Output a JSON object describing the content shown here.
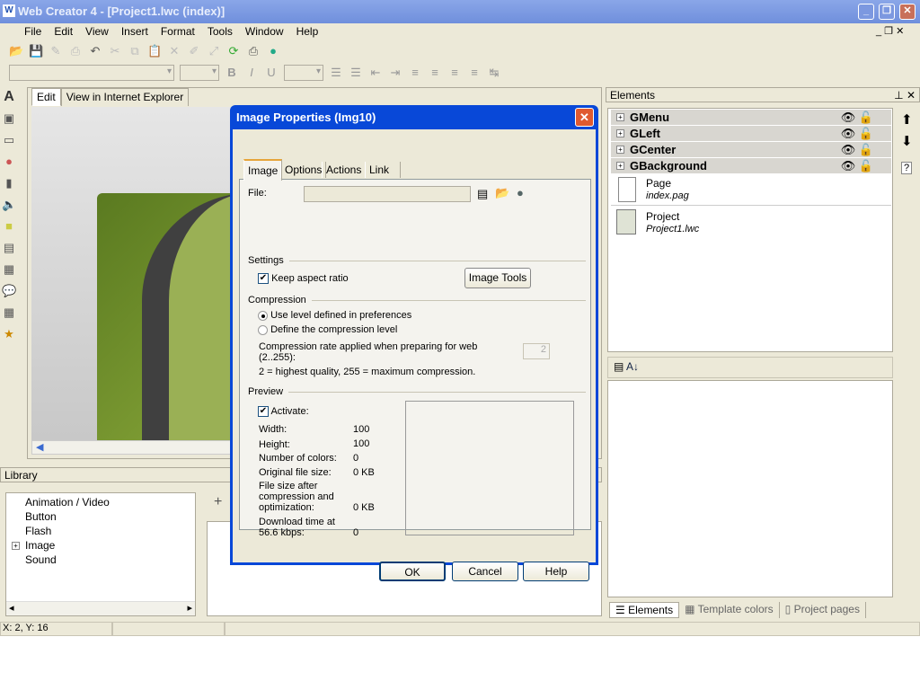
{
  "window": {
    "title": "Web Creator 4 - [Project1.lwc (index)]"
  },
  "menu": [
    "File",
    "Edit",
    "View",
    "Insert",
    "Format",
    "Tools",
    "Window",
    "Help"
  ],
  "editor": {
    "tabs": [
      "Edit",
      "View in Internet Explorer"
    ]
  },
  "library": {
    "title": "Library",
    "items": [
      "Animation / Video",
      "Button",
      "Flash",
      "Image",
      "Sound"
    ]
  },
  "status": {
    "coords": "X: 2, Y: 16"
  },
  "dialog": {
    "title": "Image Properties (Img10)",
    "tabs": [
      "Image",
      "Options",
      "Actions",
      "Link"
    ],
    "file_label": "File:",
    "file_value": "",
    "settings": "Settings",
    "keep_aspect": "Keep aspect ratio",
    "keep_aspect_checked": true,
    "image_tools": "Image Tools",
    "compression": "Compression",
    "use_level": "Use level defined in preferences",
    "define_level": "Define the compression level",
    "rate_text": "Compression rate applied when preparing for web (2..255):",
    "rate_value": "2",
    "rate_hint": "2 = highest quality, 255 = maximum compression.",
    "preview": "Preview",
    "activate": "Activate:",
    "activate_checked": true,
    "props": [
      {
        "k": "Width:",
        "v": "100"
      },
      {
        "k": "Height:",
        "v": "100"
      },
      {
        "k": "Number of colors:",
        "v": "0"
      },
      {
        "k": "Original file size:",
        "v": "0 KB"
      },
      {
        "k": "File size after compression and optimization:",
        "v": "0 KB"
      },
      {
        "k": "Download time at 56.6 kbps:",
        "v": "0"
      }
    ],
    "ok": "OK",
    "cancel": "Cancel",
    "help": "Help"
  },
  "elements": {
    "title": "Elements",
    "groups": [
      "GMenu",
      "GLeft",
      "GCenter",
      "GBackground"
    ],
    "page": {
      "label": "Page",
      "file": "index.pag"
    },
    "project": {
      "label": "Project",
      "file": "Project1.lwc"
    },
    "bottom_tabs": [
      "Elements",
      "Template colors",
      "Project pages"
    ]
  }
}
